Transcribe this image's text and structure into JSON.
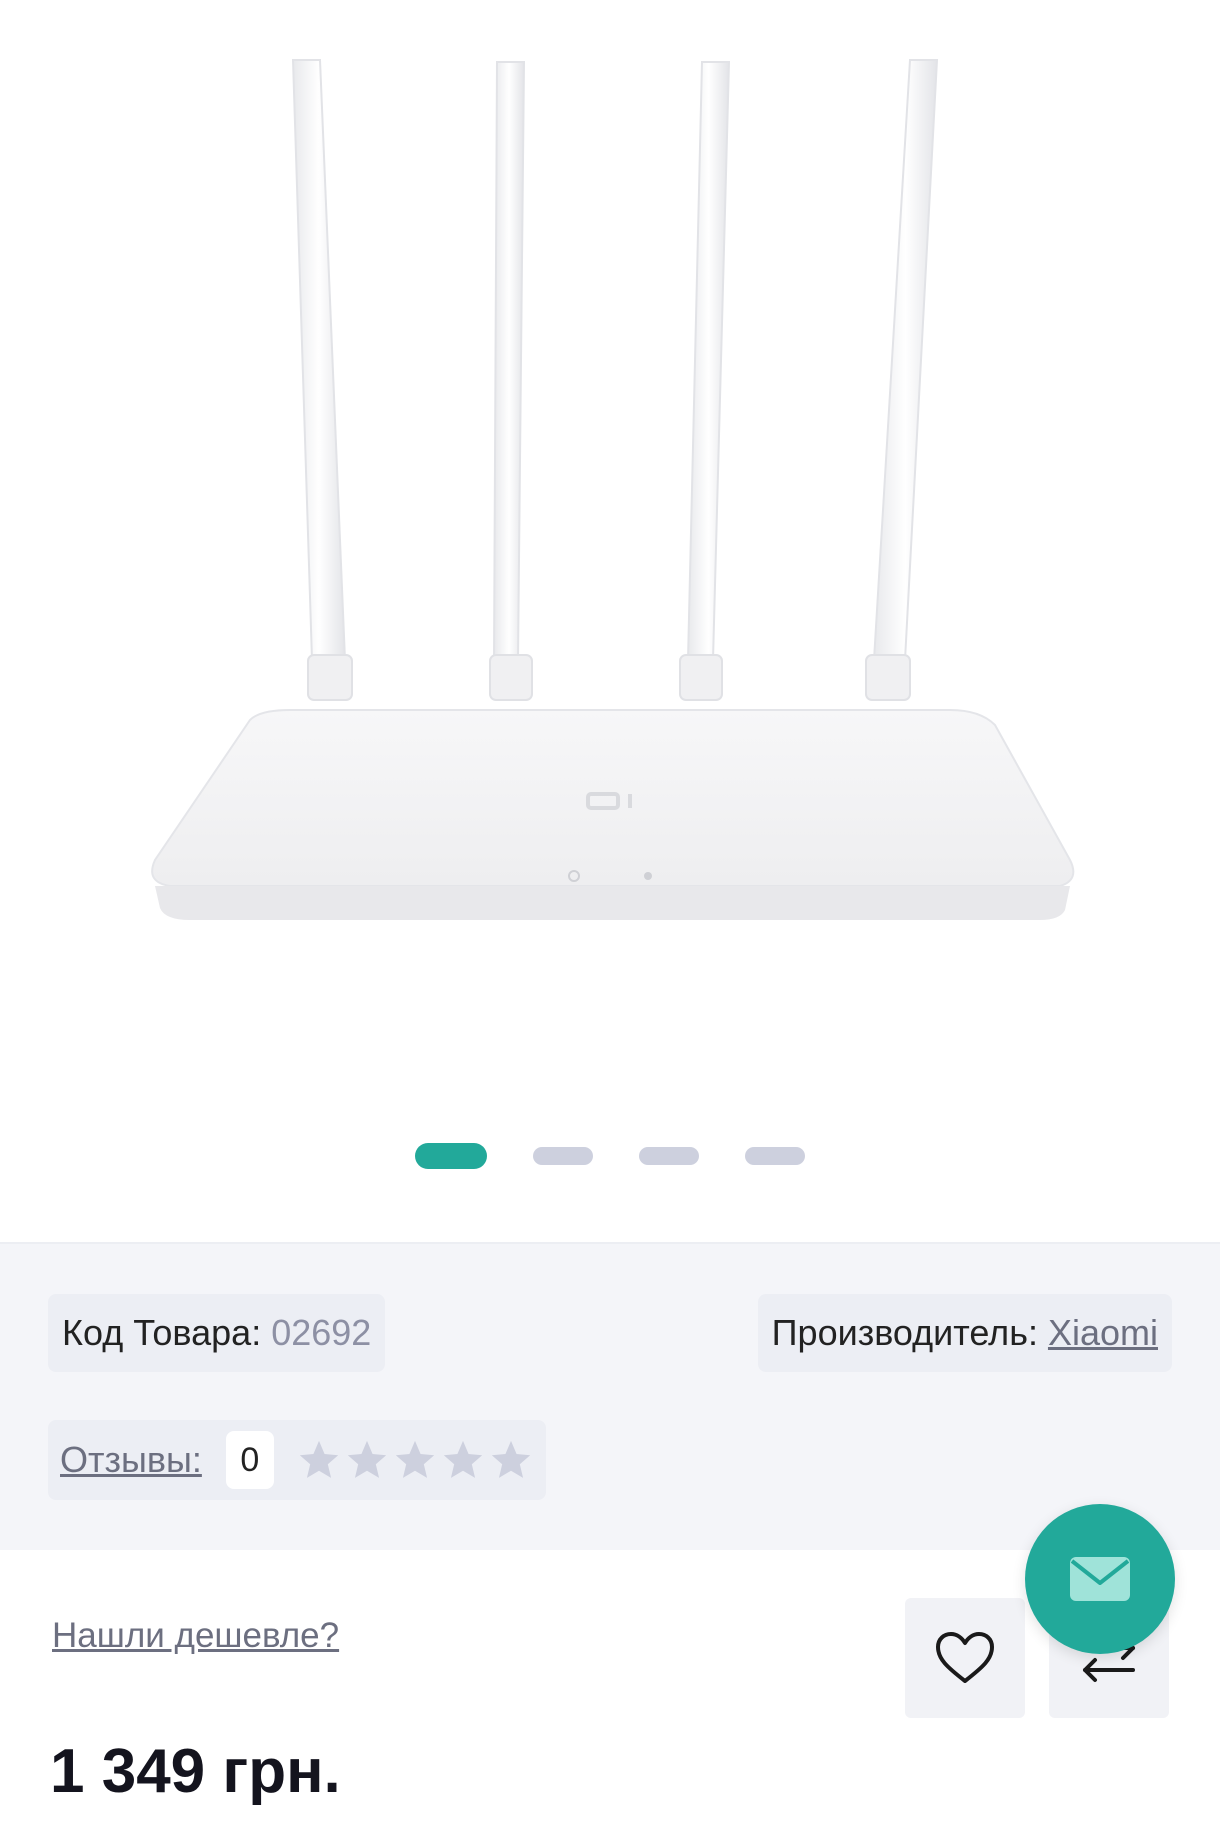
{
  "product": {
    "image_alt": "Xiaomi Mi Router 4A white router with four antennas",
    "gallery": {
      "slides": 4,
      "active": 1
    }
  },
  "info": {
    "code_label": "Код Товара:",
    "code_value": "02692",
    "brand_label": "Производитель:",
    "brand_value": "Xiaomi",
    "reviews_label": "Отзывы:",
    "reviews_count": "0",
    "rating": 0,
    "rating_max": 5
  },
  "bottom": {
    "cheaper_link": "Нашли дешевле?",
    "price": "1 349 грн."
  },
  "colors": {
    "accent": "#22a99a",
    "inactive_dot": "#cdd0de",
    "star_empty": "#cdd0de"
  },
  "icons": {
    "wishlist": "heart-icon",
    "compare": "compare-arrows-icon",
    "mail": "envelope-icon",
    "star": "star-icon"
  }
}
